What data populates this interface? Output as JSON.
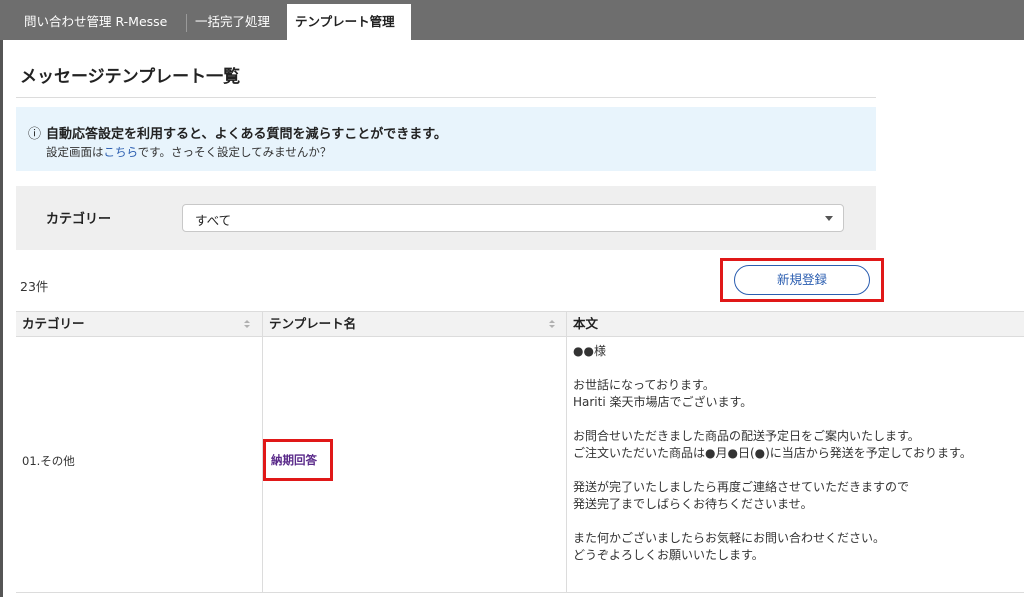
{
  "tabs": [
    {
      "label": "問い合わせ管理 R-Messe",
      "active": false
    },
    {
      "label": "一括完了処理",
      "active": false
    },
    {
      "label": "テンプレート管理",
      "active": true
    }
  ],
  "page": {
    "title": "メッセージテンプレート一覧"
  },
  "info": {
    "icon": "info-circle-icon",
    "message": "自動応答設定を利用すると、よくある質問を減らすことができます。",
    "sub_prefix": "設定画面は",
    "sub_link": "こちら",
    "sub_suffix": "です。さっそく設定してみませんか？"
  },
  "filter": {
    "label": "カテゴリー",
    "selected": "すべて"
  },
  "list": {
    "count": "23件",
    "new_button": "新規登録"
  },
  "table": {
    "headers": {
      "category": "カテゴリー",
      "name": "テンプレート名",
      "body": "本文"
    },
    "rows": [
      {
        "category": "01.その他",
        "name": "納期回答",
        "body": [
          "●●様",
          "",
          "お世話になっております。",
          "Hariti 楽天市場店でございます。",
          "",
          "お問合せいただきました商品の配送予定日をご案内いたします。",
          "ご注文いただいた商品は●月●日(●)に当店から発送を予定しております。",
          "",
          "発送が完了いたしましたら再度ご連絡させていただきますので",
          "発送完了までしばらくお待ちくださいませ。",
          "",
          "また何かございましたらお気軽にお問い合わせください。",
          "どうぞよろしくお願いいたします。"
        ]
      }
    ]
  },
  "colors": {
    "highlight": "#e01818",
    "link": "#2a5db0",
    "topbar": "#6e6e6e",
    "info_bg": "#e8f4fc"
  }
}
